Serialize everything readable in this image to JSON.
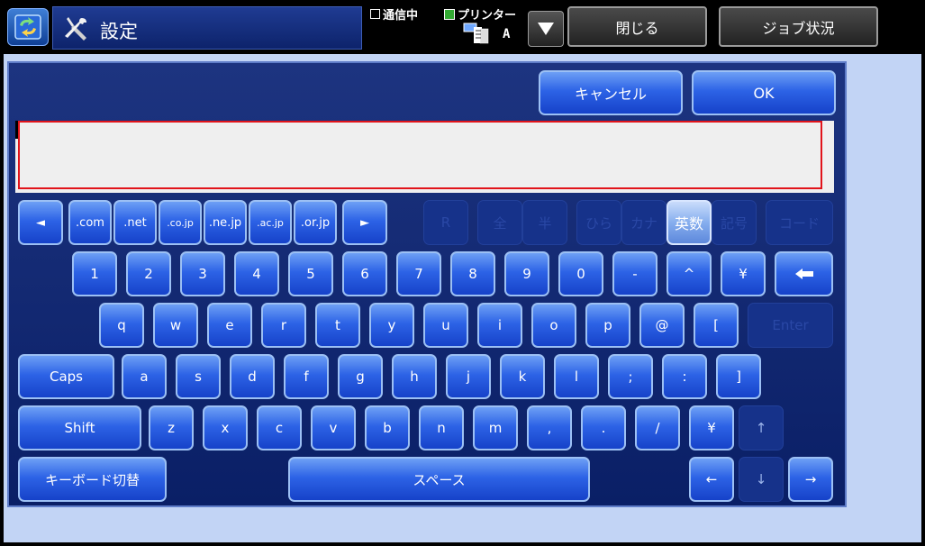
{
  "header": {
    "title": "設定",
    "status_comm": "通信中",
    "status_printer": "プリンター",
    "paper": "A",
    "close_label": "閉じる",
    "job_status_label": "ジョブ状況"
  },
  "dialog": {
    "cancel_label": "キャンセル",
    "ok_label": "OK",
    "input_value": ""
  },
  "domain_row": [
    ".com",
    ".net",
    ".co.jp",
    ".ne.jp",
    ".ac.jp",
    ".or.jp"
  ],
  "mode_row": {
    "r": "R",
    "full": "全",
    "half": "半",
    "hira": "ひら",
    "kana": "カナ",
    "eisu": "英数",
    "kigo": "記号",
    "code": "コード"
  },
  "rows": {
    "numbers": [
      "1",
      "2",
      "3",
      "4",
      "5",
      "6",
      "7",
      "8",
      "9",
      "0",
      "-",
      "^",
      "¥"
    ],
    "qwerty": [
      "q",
      "w",
      "e",
      "r",
      "t",
      "y",
      "u",
      "i",
      "o",
      "p",
      "@",
      "["
    ],
    "asdf": [
      "a",
      "s",
      "d",
      "f",
      "g",
      "h",
      "j",
      "k",
      "l",
      ";",
      ":",
      "]"
    ],
    "zxcv": [
      "z",
      "x",
      "c",
      "v",
      "b",
      "n",
      "m",
      ",",
      ".",
      "/",
      "¥"
    ]
  },
  "special": {
    "enter": "Enter",
    "caps": "Caps",
    "shift": "Shift",
    "keyboard_switch": "キーボード切替",
    "space": "スペース",
    "left_arrow": "◄",
    "right_arrow": "►",
    "up": "↑",
    "down": "↓",
    "left": "←",
    "right": "→"
  }
}
